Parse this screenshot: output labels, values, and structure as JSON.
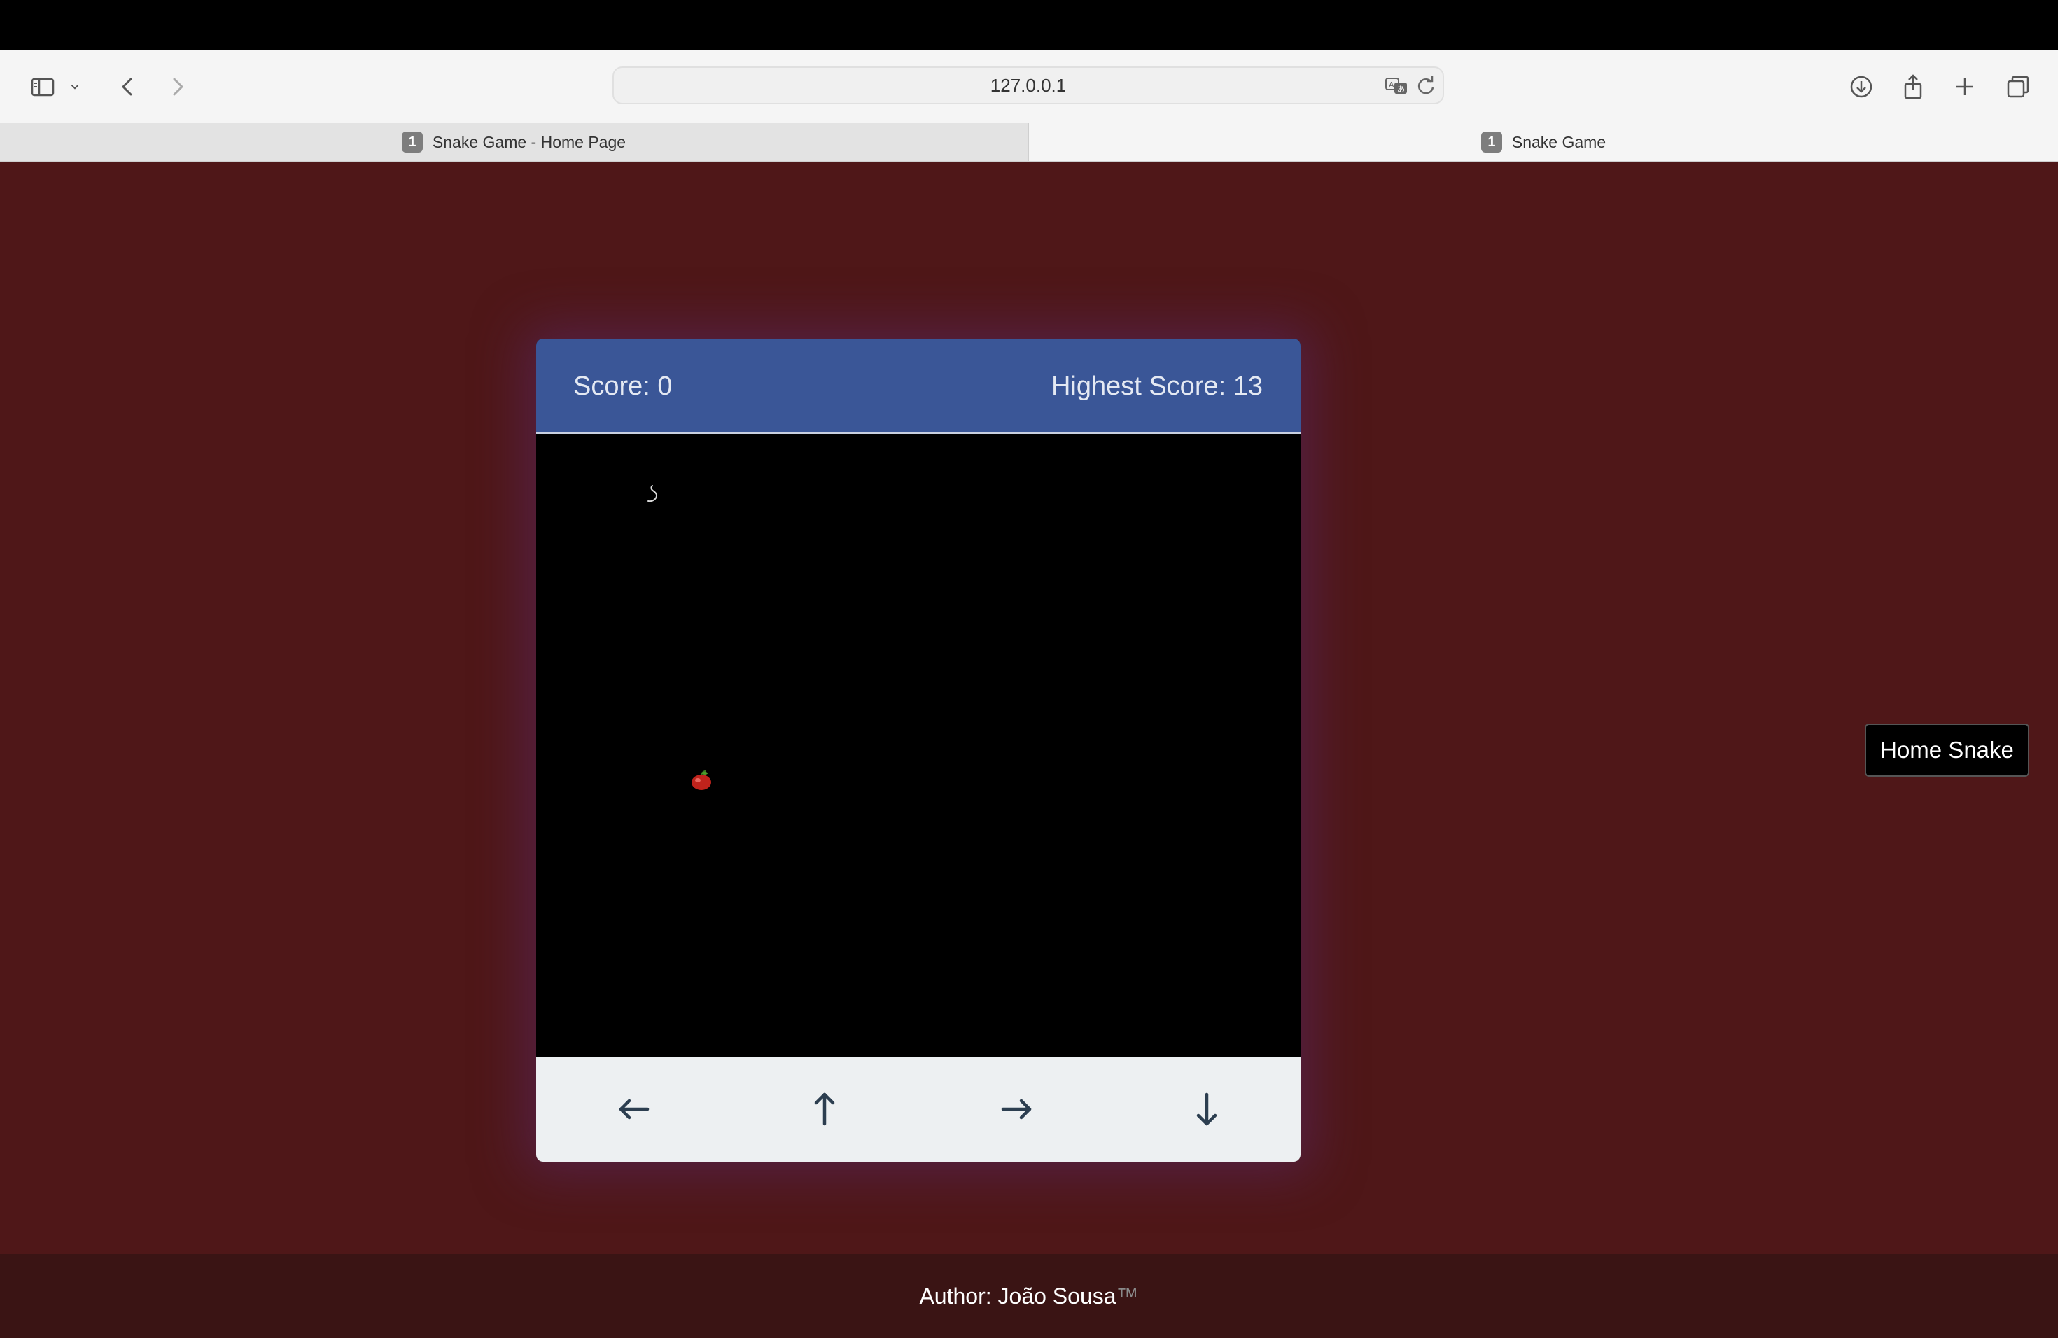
{
  "browser": {
    "url": "127.0.0.1",
    "tabs": [
      {
        "label": "Snake Game - Home Page",
        "badge": "1",
        "active": false
      },
      {
        "label": "Snake Game",
        "badge": "1",
        "active": true
      }
    ],
    "icons": [
      "sidebar-icon",
      "chevron-down-icon",
      "back-icon",
      "forward-icon",
      "translate-icon",
      "reload-icon",
      "download-icon",
      "share-icon",
      "new-tab-icon",
      "tab-overview-icon"
    ]
  },
  "game": {
    "score_label": "Score: 0",
    "highest_score_label": "Highest Score: 13",
    "controls": [
      {
        "name": "left",
        "glyph": "←"
      },
      {
        "name": "up",
        "glyph": "↑"
      },
      {
        "name": "right",
        "glyph": "→"
      },
      {
        "name": "down",
        "glyph": "↓"
      }
    ]
  },
  "side_button": {
    "label": "Home Snake"
  },
  "footer": {
    "author": "Author: João Sousa",
    "tm": "™"
  },
  "colors": {
    "page_bg": "#4f1718",
    "header_bg": "#3a5697",
    "board_bg": "#000000",
    "controls_bg": "#edf0f2",
    "footer_bg": "#3a1414"
  }
}
